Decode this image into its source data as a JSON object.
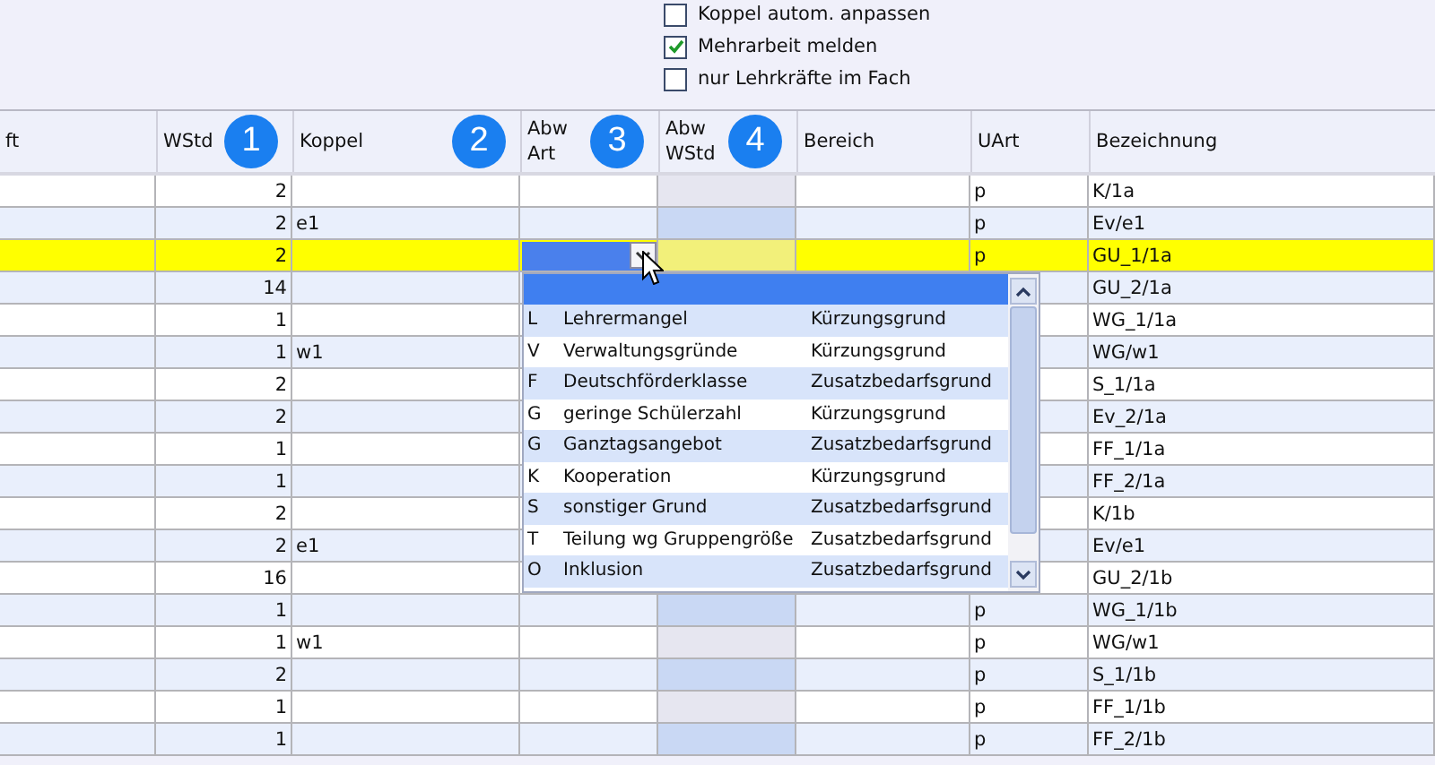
{
  "options": [
    {
      "label": "Koppel autom. anpassen",
      "checked": false
    },
    {
      "label": "Mehrarbeit melden",
      "checked": true
    },
    {
      "label": "nur Lehrkräfte im Fach",
      "checked": false
    }
  ],
  "table": {
    "columns": [
      {
        "label": "ft"
      },
      {
        "label": "WStd",
        "badge": "1"
      },
      {
        "label": "Koppel",
        "badge": "2"
      },
      {
        "label": "Abw Art",
        "badge": "3"
      },
      {
        "label": "Abw WStd",
        "badge": "4"
      },
      {
        "label": "Bereich"
      },
      {
        "label": "UArt"
      },
      {
        "label": "Bezeichnung"
      }
    ],
    "rows": [
      {
        "wstd": "2",
        "uart": "p",
        "bezeichnung": "K/1a",
        "selected": false
      },
      {
        "wstd": "2",
        "koppel": "e1",
        "uart": "p",
        "bezeichnung": "Ev/e1",
        "selected": false
      },
      {
        "wstd": "2",
        "uart": "p",
        "bezeichnung": "GU_1/1a",
        "selected": true
      },
      {
        "wstd": "14",
        "bezeichnung": "GU_2/1a",
        "selected": false
      },
      {
        "wstd": "1",
        "bezeichnung": "WG_1/1a",
        "selected": false
      },
      {
        "wstd": "1",
        "koppel": "w1",
        "bezeichnung": "WG/w1",
        "selected": false
      },
      {
        "wstd": "2",
        "bezeichnung": "S_1/1a",
        "selected": false
      },
      {
        "wstd": "2",
        "bezeichnung": "Ev_2/1a",
        "selected": false
      },
      {
        "wstd": "1",
        "bezeichnung": "FF_1/1a",
        "selected": false
      },
      {
        "wstd": "1",
        "bezeichnung": "FF_2/1a",
        "selected": false
      },
      {
        "wstd": "2",
        "bezeichnung": "K/1b",
        "selected": false
      },
      {
        "wstd": "2",
        "koppel": "e1",
        "bezeichnung": "Ev/e1",
        "selected": false
      },
      {
        "wstd": "16",
        "bezeichnung": "GU_2/1b",
        "selected": false
      },
      {
        "wstd": "1",
        "uart": "p",
        "bezeichnung": "WG_1/1b",
        "selected": false
      },
      {
        "wstd": "1",
        "koppel": "w1",
        "uart": "p",
        "bezeichnung": "WG/w1",
        "selected": false
      },
      {
        "wstd": "2",
        "uart": "p",
        "bezeichnung": "S_1/1b",
        "selected": false
      },
      {
        "wstd": "1",
        "uart": "p",
        "bezeichnung": "FF_1/1b",
        "selected": false
      },
      {
        "wstd": "1",
        "uart": "p",
        "bezeichnung": "FF_2/1b",
        "selected": false
      }
    ]
  },
  "dropdown": {
    "options": [
      {
        "code": "L",
        "label": "Lehrermangel",
        "category": "Kürzungsgrund"
      },
      {
        "code": "V",
        "label": "Verwaltungsgründe",
        "category": "Kürzungsgrund"
      },
      {
        "code": "F",
        "label": "Deutschförderklasse",
        "category": "Zusatzbedarfsgrund"
      },
      {
        "code": "G",
        "label": "geringe Schülerzahl",
        "category": "Kürzungsgrund"
      },
      {
        "code": "G",
        "label": "Ganztagsangebot",
        "category": "Zusatzbedarfsgrund"
      },
      {
        "code": "K",
        "label": "Kooperation",
        "category": "Kürzungsgrund"
      },
      {
        "code": "S",
        "label": "sonstiger Grund",
        "category": "Zusatzbedarfsgrund"
      },
      {
        "code": "T",
        "label": "Teilung wg Gruppengröße",
        "category": "Zusatzbedarfsgrund"
      },
      {
        "code": "O",
        "label": "Inklusion",
        "category": "Zusatzbedarfsgrund"
      }
    ]
  }
}
